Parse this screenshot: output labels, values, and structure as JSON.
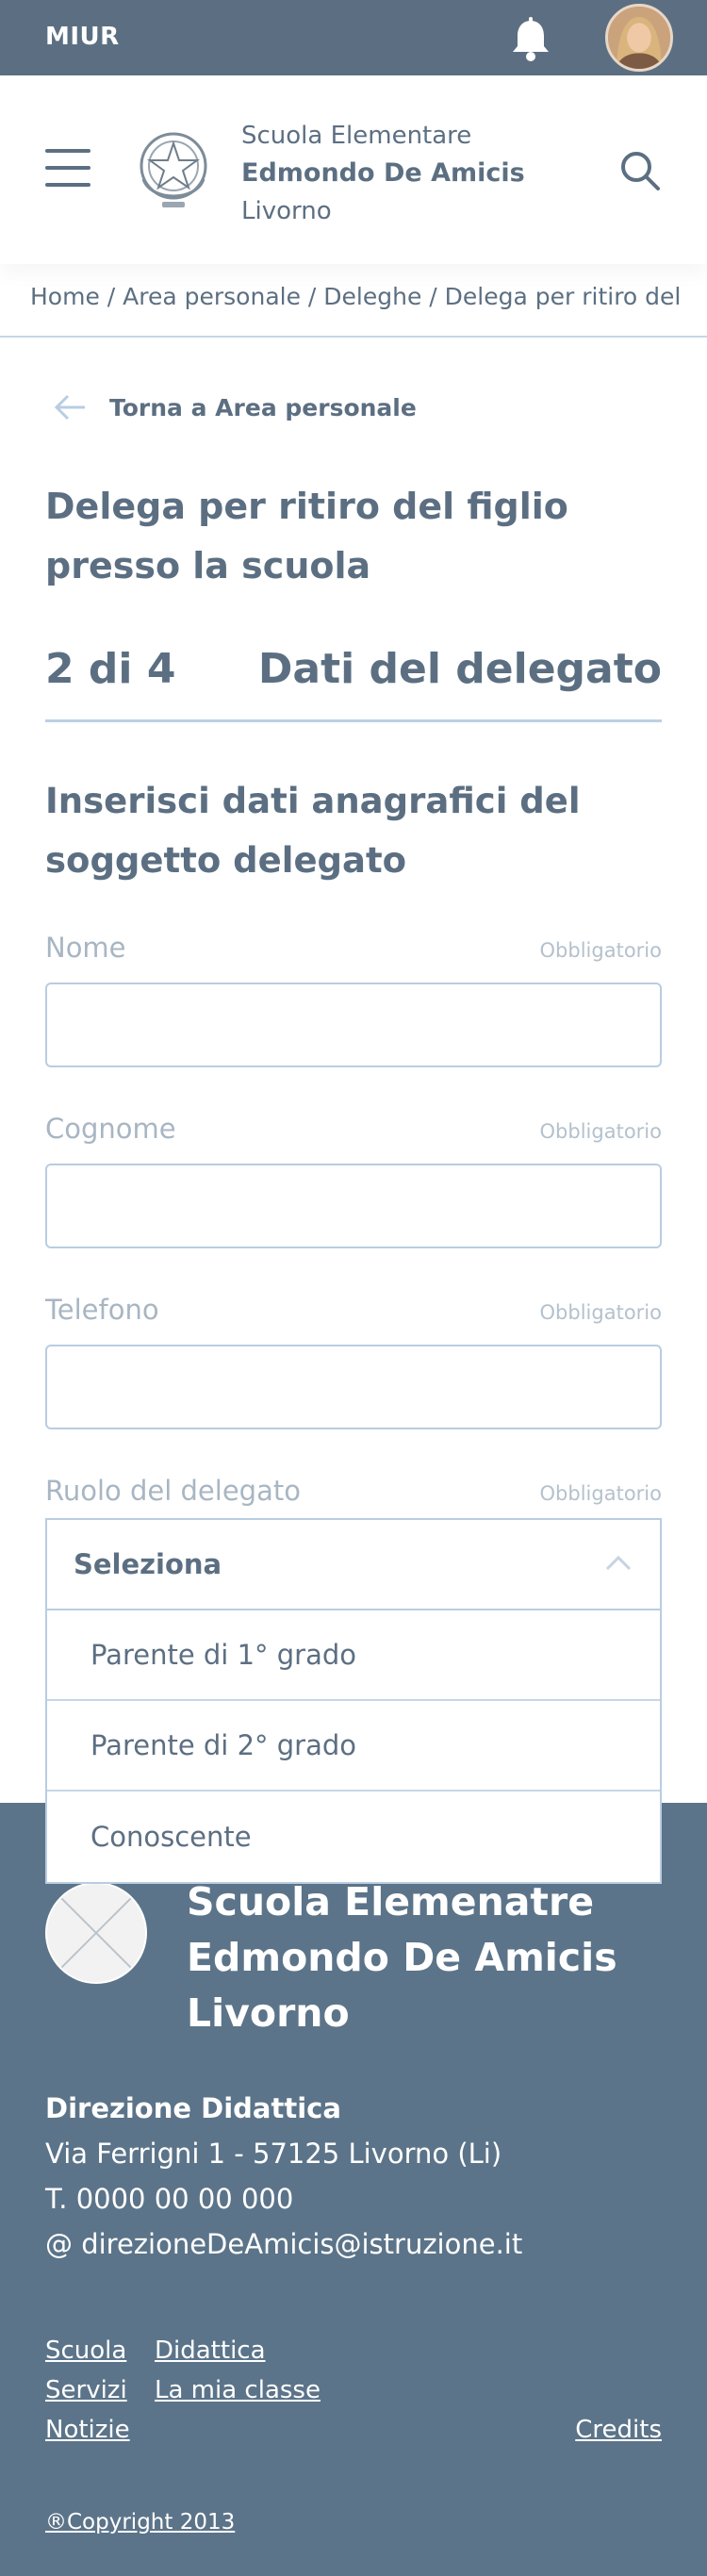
{
  "topbar": {
    "brand": "MIUR",
    "bell_icon": "bell-icon",
    "avatar": "user-avatar"
  },
  "header": {
    "menu_icon": "hamburger-menu-icon",
    "emblem": "italian-republic-emblem",
    "school_type": "Scuola Elementare",
    "school_name": "Edmondo De Amicis",
    "school_city": "Livorno",
    "search_icon": "search-icon"
  },
  "breadcrumb": {
    "text": "Home / Area personale / Deleghe / Delega per ritiro del figlio presso la scuola"
  },
  "back_link": {
    "label": "Torna a Area personale",
    "icon": "arrow-left-icon"
  },
  "page": {
    "title_line1": "Delega per ritiro del figlio",
    "title_line2": "presso la scuola"
  },
  "stepper": {
    "step": "2 di 4",
    "label": "Dati del delegato"
  },
  "form": {
    "heading": "Inserisci dati anagrafici del soggetto delegato",
    "required_label": "Obbligatorio",
    "fields": [
      {
        "label": "Nome",
        "value": ""
      },
      {
        "label": "Cognome",
        "value": ""
      },
      {
        "label": "Telefono",
        "value": ""
      }
    ],
    "role": {
      "label": "Ruolo del delegato",
      "selected": "Seleziona",
      "options": [
        "Parente di 1° grado",
        "Parente di 2° grado",
        "Conoscente"
      ]
    }
  },
  "footer": {
    "school_line1": "Scuola Elemenatre",
    "school_line2": "Edmondo De Amicis",
    "school_line3": "Livorno",
    "direction_title": "Direzione Didattica",
    "address": "Via Ferrigni 1 - 57125 Livorno (Li)",
    "phone": "T. 0000 00 00 000",
    "email": "@ direzioneDeAmicis@istruzione.it",
    "links_col1": [
      "Scuola",
      "Servizi",
      "Notizie"
    ],
    "links_col2": [
      "Didattica",
      "La mia classe"
    ],
    "credits": "Credits",
    "copyright": "®Copyright 2013"
  },
  "colors": {
    "primary": "#5c6f82",
    "footer_bg": "#5c7489",
    "border": "#b9cde2",
    "muted_label": "#a8b6c3"
  }
}
